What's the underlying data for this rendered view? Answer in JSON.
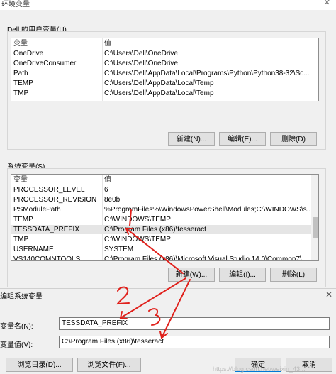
{
  "window": {
    "title": "环境变量",
    "close": "✕"
  },
  "user_section": {
    "label": "Dell 的用户变量(U)",
    "headers": {
      "name": "变量",
      "value": "值"
    },
    "rows": [
      {
        "name": "OneDrive",
        "value": "C:\\Users\\Dell\\OneDrive"
      },
      {
        "name": "OneDriveConsumer",
        "value": "C:\\Users\\Dell\\OneDrive"
      },
      {
        "name": "Path",
        "value": "C:\\Users\\Dell\\AppData\\Local\\Programs\\Python\\Python38-32\\Sc..."
      },
      {
        "name": "TEMP",
        "value": "C:\\Users\\Dell\\AppData\\Local\\Temp"
      },
      {
        "name": "TMP",
        "value": "C:\\Users\\Dell\\AppData\\Local\\Temp"
      }
    ],
    "buttons": {
      "new": "新建(N)...",
      "edit": "编辑(E)...",
      "delete": "删除(D)"
    }
  },
  "system_section": {
    "label": "系统变量(S)",
    "headers": {
      "name": "变量",
      "value": "值"
    },
    "rows": [
      {
        "name": "PROCESSOR_LEVEL",
        "value": "6"
      },
      {
        "name": "PROCESSOR_REVISION",
        "value": "8e0b"
      },
      {
        "name": "PSModulePath",
        "value": "%ProgramFiles%\\WindowsPowerShell\\Modules;C:\\WINDOWS\\s..."
      },
      {
        "name": "TEMP",
        "value": "C:\\WINDOWS\\TEMP"
      },
      {
        "name": "TESSDATA_PREFIX",
        "value": "C:\\Program Files (x86)\\tesseract"
      },
      {
        "name": "TMP",
        "value": "C:\\WINDOWS\\TEMP"
      },
      {
        "name": "USERNAME",
        "value": "SYSTEM"
      },
      {
        "name": "VS140COMNTOOLS",
        "value": "C:\\Program Files (x86)\\Microsoft Visual Studio 14.0\\Common7\\..."
      }
    ],
    "buttons": {
      "new": "新建(W)...",
      "edit": "编辑(I)...",
      "delete": "删除(L)"
    }
  },
  "edit_dialog": {
    "title": "编辑系统变量",
    "close": "✕",
    "name_label": "变量名(N):",
    "name_value": "TESSDATA_PREFIX",
    "value_label": "变量值(V):",
    "value_value": "C:\\Program Files (x86)\\tesseract",
    "browse_dir": "浏览目录(D)...",
    "browse_file": "浏览文件(F)...",
    "ok": "确定",
    "cancel": "取消"
  },
  "annotations": {
    "n1": "1",
    "n2": "2",
    "n3": "3",
    "color": "#e0201b"
  },
  "watermark": "https://blog.csdn.net/weixin_43..."
}
